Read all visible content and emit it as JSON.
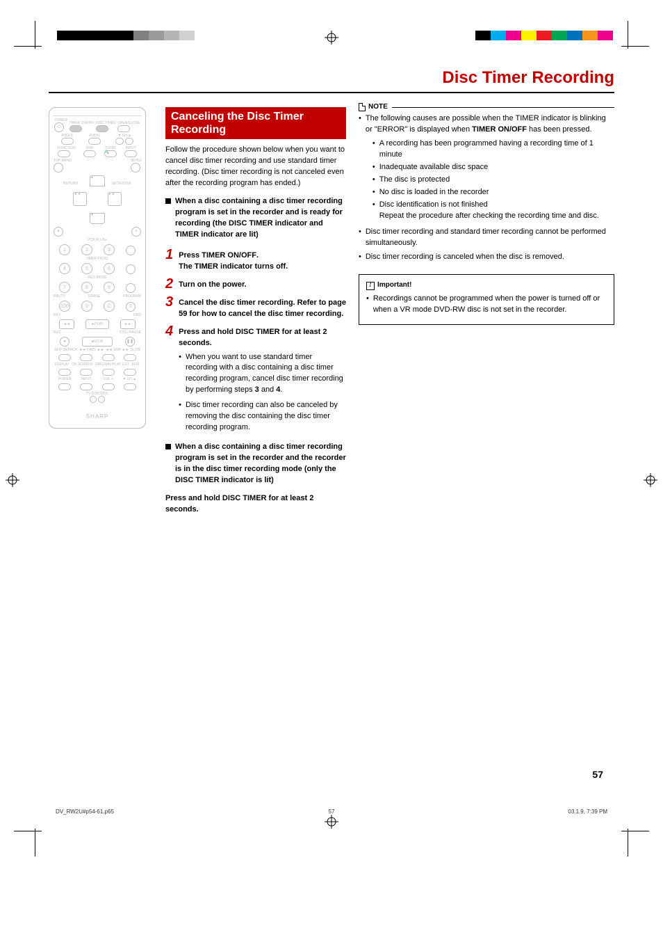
{
  "page": {
    "title": "Disc Timer Recording",
    "number": "57"
  },
  "section": {
    "heading": "Canceling the Disc Timer Recording",
    "intro": "Follow the procedure shown below when you want to cancel disc timer recording and use standard timer recording. (Disc timer recording is not canceled even after the recording program has ended.)",
    "condition1": "When a disc containing a disc timer recording program is set in the recorder and is ready for recording (the DISC TIMER indicator and TIMER indicator are lit)",
    "steps": {
      "s1_lead1": "Press ",
      "s1_bold": "TIMER ON/OFF",
      "s1_lead2": ".",
      "s1_line2": "The TIMER indicator turns off.",
      "s2": "Turn on the power.",
      "s3": "Cancel the disc timer recording. Refer to page 59 for how to cancel the disc timer recording.",
      "s4_lead1": "Press and hold ",
      "s4_bold": "DISC TIMER",
      "s4_lead2": " for at least 2 seconds.",
      "s4_sub1_a": "When you want to use standard timer recording with a disc containing a disc timer recording program, cancel disc timer recording by performing steps ",
      "s4_sub1_b": "3",
      "s4_sub1_c": " and ",
      "s4_sub1_d": "4",
      "s4_sub1_e": ".",
      "s4_sub2": "Disc timer recording can also be canceled by removing the disc containing the disc timer recording program."
    },
    "condition2": "When a disc containing a disc timer recording program is set in the recorder and the recorder is in the disc timer recording mode (only the DISC TIMER indicator is lit)",
    "final_a": "Press and hold ",
    "final_b": "DISC TIMER",
    "final_c": " for at least 2 seconds."
  },
  "note": {
    "label": "NOTE",
    "intro_a": "The following causes are possible when the TIMER indicator is blinking or \"ERROR\" is displayed when ",
    "intro_b": "TIMER ON/OFF",
    "intro_c": " has been pressed.",
    "causes": {
      "c1": "A recording has been programmed having a recording time of 1 minute",
      "c2": "Inadequate available disc space",
      "c3": "The disc is protected",
      "c4": "No disc is loaded in the recorder",
      "c5a": "Disc identification is not finished",
      "c5b": "Repeat the procedure after checking the recording time and disc."
    },
    "extra1": "Disc timer recording and standard timer recording cannot be performed simultaneously.",
    "extra2": "Disc timer recording is canceled when the disc is removed."
  },
  "important": {
    "label": "Important!",
    "text": "Recordings cannot be programmed when the power is turned off or when a VR mode DVD-RW disc is not set in the recorder."
  },
  "footer": {
    "file": "DV_RW2U#p54-61.p65",
    "page": "57",
    "timestamp": "03.1.9, 7:39 PM"
  },
  "remote": {
    "brand": "SHARP",
    "row1": [
      "POWER",
      "TIMER ON/OFF",
      "DISC TIMER",
      "OPEN/CLOSE"
    ],
    "row2": [
      "ANGLE",
      "AUDIO",
      "CH"
    ],
    "row3": [
      "FUNCTION",
      "DNR",
      "ZOOM",
      "INPUT"
    ],
    "row4": [
      "TOP MENU",
      "",
      "",
      "MENU"
    ],
    "nav": [
      "RETURN",
      "SET/ENTER"
    ],
    "vcr": "VCR PLUS+",
    "nums": [
      "1",
      "2",
      "3",
      "4",
      "5",
      "6",
      "7",
      "8",
      "9",
      "100",
      "0",
      "C"
    ],
    "side_lbl": [
      "TIMER PROG.",
      "REC.MODE",
      "ERASE",
      "PROGRAM",
      "G"
    ],
    "transport": [
      "REV",
      "PLAY",
      "FWD",
      "REC",
      "STOP",
      "STILL/PAUSE"
    ],
    "bottom1": [
      "SKIP SEARCH",
      "F.ADV",
      "SKIP"
    ],
    "bottom2": [
      "DISPLAY",
      "ON SCREEN",
      "ORIGINAL/PLAY LIST",
      "EDIT"
    ],
    "bottom3": [
      "POWER",
      "INPUT",
      "VOL",
      "CH"
    ],
    "tv": "TV CONTROL"
  },
  "colors": {
    "bars_left": [
      "#000",
      "#000",
      "#000",
      "#000",
      "#000",
      "#808080",
      "#808080",
      "#808080",
      "#808080"
    ],
    "bars_right": [
      "#000",
      "#00AEEF",
      "#EC008C",
      "#FFF200",
      "#ED1C24",
      "#00A651",
      "#0072BC",
      "#F7941E",
      "#EC008C"
    ]
  }
}
